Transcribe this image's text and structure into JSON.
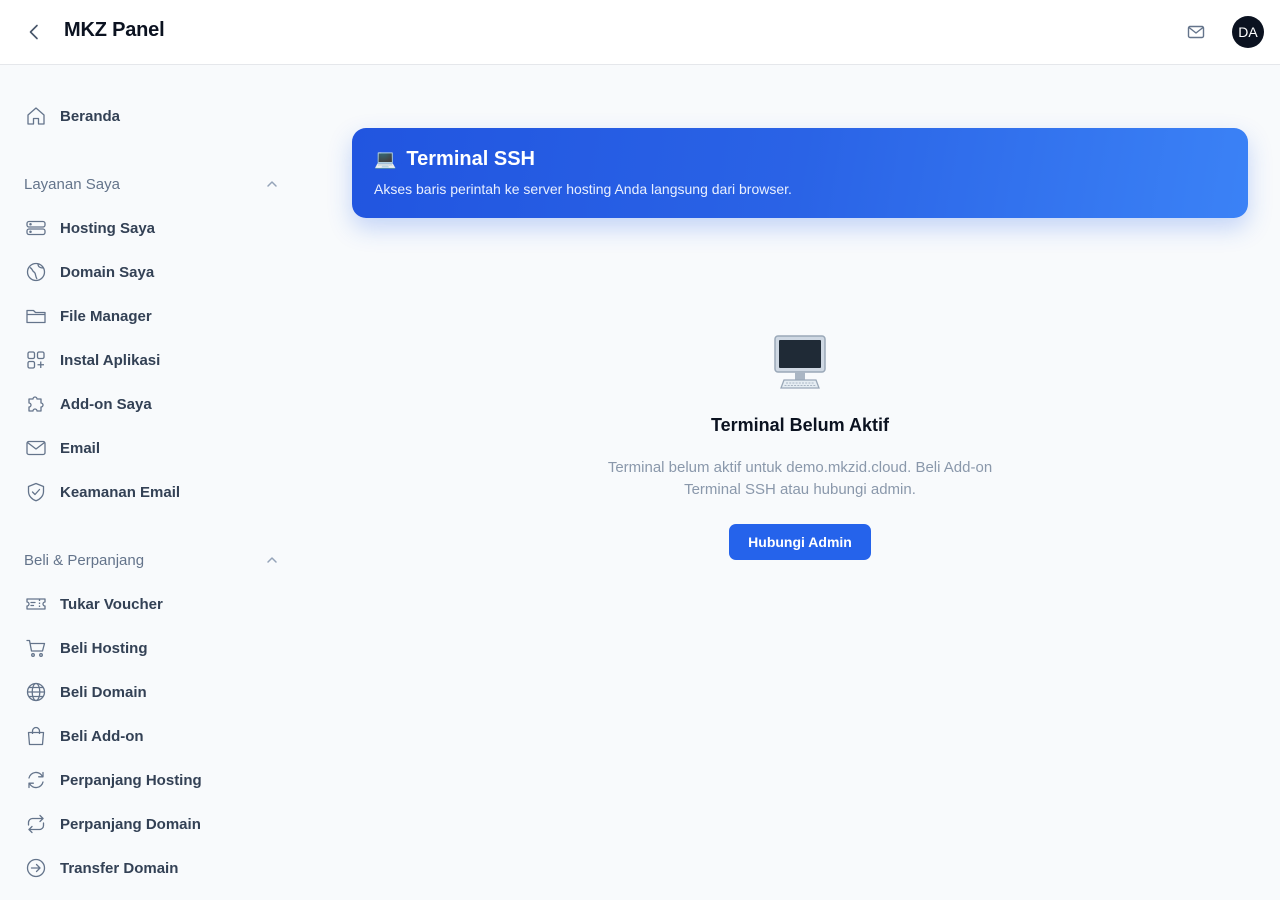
{
  "header": {
    "title": "MKZ Panel",
    "avatar_initials": "DA",
    "back_icon": "chevron-left-icon",
    "mail_icon": "mail-icon"
  },
  "sidebar": {
    "home": {
      "label": "Beranda",
      "icon": "home-icon"
    },
    "sections": [
      {
        "title": "Layanan Saya",
        "items": [
          {
            "label": "Hosting Saya",
            "icon": "server-icon"
          },
          {
            "label": "Domain Saya",
            "icon": "globe-icon"
          },
          {
            "label": "File Manager",
            "icon": "folder-icon"
          },
          {
            "label": "Instal Aplikasi",
            "icon": "apps-icon"
          },
          {
            "label": "Add-on Saya",
            "icon": "puzzle-icon"
          },
          {
            "label": "Email",
            "icon": "mail-icon"
          },
          {
            "label": "Keamanan Email",
            "icon": "shield-check-icon"
          }
        ]
      },
      {
        "title": "Beli & Perpanjang",
        "items": [
          {
            "label": "Tukar Voucher",
            "icon": "ticket-icon"
          },
          {
            "label": "Beli Hosting",
            "icon": "cart-icon"
          },
          {
            "label": "Beli Domain",
            "icon": "globe-icon"
          },
          {
            "label": "Beli Add-on",
            "icon": "shopping-bag-icon"
          },
          {
            "label": "Perpanjang Hosting",
            "icon": "refresh-icon"
          },
          {
            "label": "Perpanjang Domain",
            "icon": "refresh-alt-icon"
          },
          {
            "label": "Transfer Domain",
            "icon": "arrow-right-circle-icon"
          }
        ]
      }
    ]
  },
  "banner": {
    "emoji": "💻",
    "title": "Terminal SSH",
    "subtitle": "Akses baris perintah ke server hosting Anda langsung dari browser."
  },
  "empty_state": {
    "icon": "desktop-computer-icon",
    "title": "Terminal Belum Aktif",
    "description": "Terminal belum aktif untuk demo.mkzid.cloud. Beli Add-on Terminal SSH atau hubungi admin.",
    "button_label": "Hubungi Admin"
  },
  "colors": {
    "primary": "#2563eb",
    "banner_gradient_start": "#2155e0",
    "banner_gradient_end": "#3b82f6",
    "background": "#f8fafc",
    "sidebar_text": "#334155",
    "muted_text": "#64748b"
  }
}
